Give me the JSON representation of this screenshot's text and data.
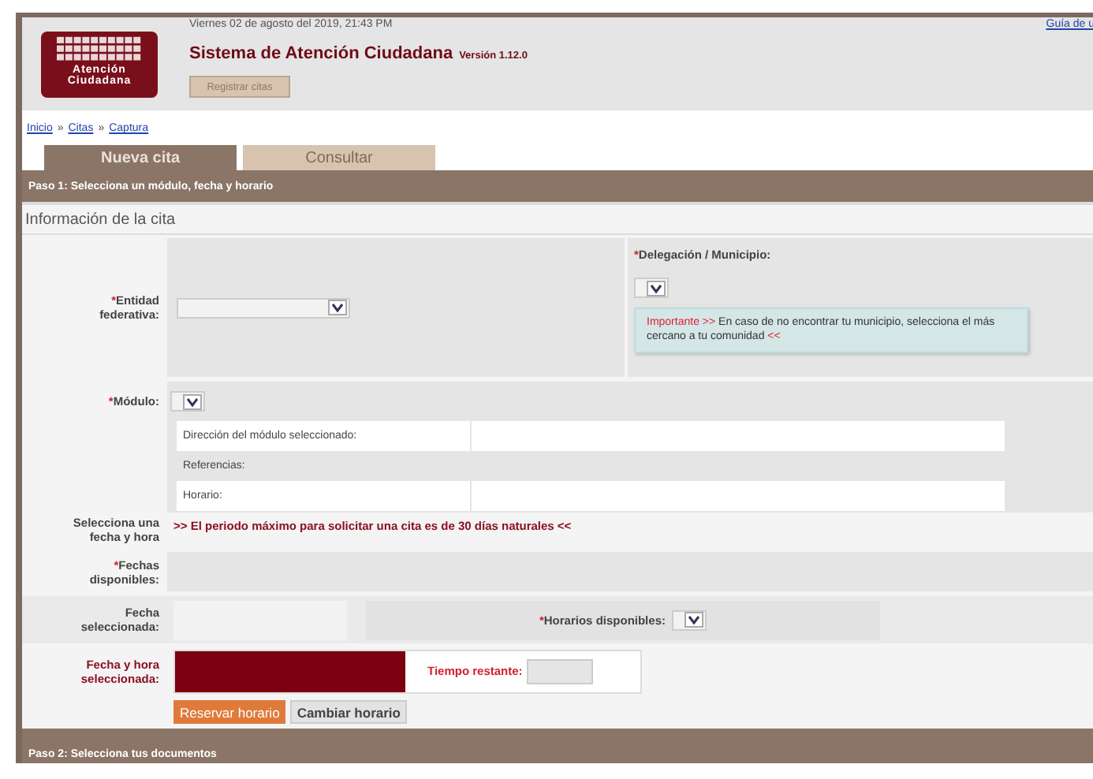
{
  "header": {
    "logo_lines": [
      "Atención",
      "Ciudadana"
    ],
    "date": "Viernes 02 de agosto del 2019, 21:43 PM",
    "title": "Sistema de Atención Ciudadana",
    "version": "Versión 1.12.0",
    "register_button": "Registrar citas",
    "guide_link": "Guía de u"
  },
  "breadcrumb": {
    "separator": "»",
    "items": [
      "Inicio",
      "Citas",
      "Captura"
    ]
  },
  "tabs": [
    {
      "label": "Nueva cita",
      "selected": true
    },
    {
      "label": "Consultar",
      "selected": false
    }
  ],
  "step1": "Paso 1: Selecciona un módulo, fecha y horario",
  "section_title": "Información de la cita",
  "entidad": {
    "mark": "*",
    "label": "Entidad federativa:"
  },
  "delegacion": {
    "mark": "*",
    "label": "Delegación / Municipio:"
  },
  "note": {
    "lead": "Importante >>",
    "text": "En caso de no encontrar tu municipio, selecciona el más cercano a tu comunidad",
    "tail": "<<"
  },
  "modulo": {
    "mark": "*",
    "label": "Módulo:"
  },
  "module_details": [
    {
      "label": "Dirección del módulo seleccionado:",
      "kind": "field"
    },
    {
      "label": "Referencias:",
      "kind": "plain"
    },
    {
      "label": "Horario:",
      "kind": "field"
    }
  ],
  "select_date": {
    "label": "Selecciona una fecha y hora",
    "notice": ">> El periodo máximo para solicitar una cita es de 30 días naturales <<"
  },
  "fechas": {
    "mark": "*",
    "label": "Fechas disponibles:"
  },
  "fecha_sel": {
    "label": "Fecha seleccionada:"
  },
  "horarios": {
    "mark": "*",
    "label": "Horarios disponibles:"
  },
  "fecha_hora": {
    "label": "Fecha y hora seleccionada:"
  },
  "tiempo": {
    "label": "Tiempo restante:"
  },
  "buttons": [
    {
      "label": "Reservar horario",
      "kind": "primary"
    },
    {
      "label": "Cambiar horario",
      "kind": "secondary"
    }
  ],
  "step2": "Paso 2: Selecciona tus documentos"
}
